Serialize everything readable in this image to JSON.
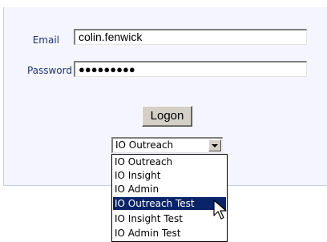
{
  "form": {
    "email_label": "Email",
    "email_value": "colin.fenwick",
    "password_label": "Password",
    "password_value": "●●●●●●●●●",
    "logon_label": "Logon"
  },
  "app_select": {
    "selected": "IO Outreach",
    "options": [
      {
        "label": "IO Outreach",
        "highlighted": false
      },
      {
        "label": "IO Insight",
        "highlighted": false
      },
      {
        "label": "IO Admin",
        "highlighted": false
      },
      {
        "label": "IO Outreach Test",
        "highlighted": true
      },
      {
        "label": "IO Insight Test",
        "highlighted": false
      },
      {
        "label": "IO Admin Test",
        "highlighted": false
      }
    ]
  },
  "colors": {
    "panel_bg": "#f4f5fe",
    "label_text": "#1f3478",
    "highlight": "#0a246a"
  },
  "icons": {
    "cursor": "arrow-cursor-icon"
  }
}
